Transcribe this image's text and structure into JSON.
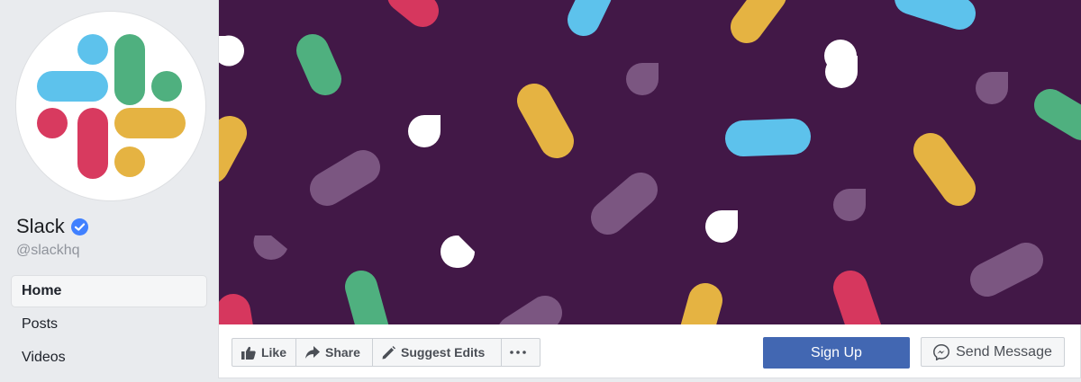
{
  "page": {
    "name": "Slack",
    "handle": "@slackhq"
  },
  "nav": {
    "items": [
      {
        "label": "Home"
      },
      {
        "label": "Posts"
      },
      {
        "label": "Videos"
      }
    ]
  },
  "actions": {
    "like": "Like",
    "share": "Share",
    "suggest_edits": "Suggest Edits",
    "sign_up": "Sign Up",
    "send_message": "Send Message"
  },
  "colors": {
    "cover_bg": "#421847",
    "slack_blue": "#36c5f0",
    "slack_green": "#2eb67d",
    "slack_red": "#e01e5a",
    "slack_yellow": "#ecb22e",
    "brand_button": "#4267b2",
    "verified": "#4080ff"
  },
  "icons": {
    "verified": "verified-badge-icon",
    "like": "thumbs-up-icon",
    "share": "share-arrow-icon",
    "suggest_edits": "pencil-icon",
    "more": "more-dots-icon",
    "messenger": "messenger-icon"
  }
}
